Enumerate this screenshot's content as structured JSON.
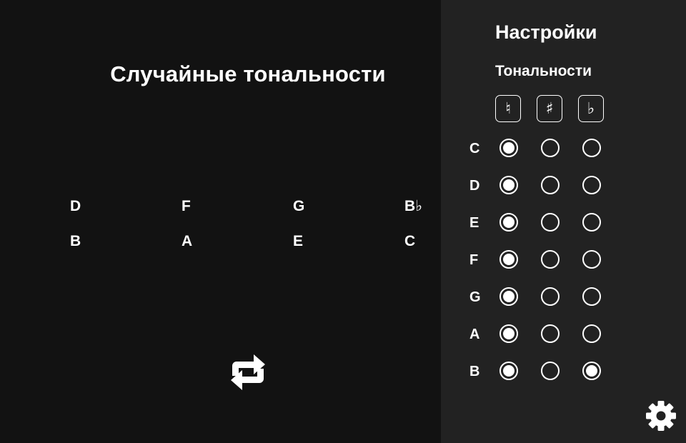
{
  "main": {
    "title": "Случайные тональности",
    "keys": [
      "D",
      "F",
      "G",
      "B♭",
      "B",
      "A",
      "E",
      "C"
    ],
    "refresh_icon": "refresh-icon"
  },
  "settings": {
    "title": "Настройки",
    "section_title": "Тональности",
    "accidentals": [
      {
        "symbol": "♮",
        "icon": "natural-icon"
      },
      {
        "symbol": "♯",
        "icon": "sharp-icon"
      },
      {
        "symbol": "♭",
        "icon": "flat-icon"
      }
    ],
    "rows": [
      {
        "note": "C",
        "selected": "natural"
      },
      {
        "note": "D",
        "selected": "natural"
      },
      {
        "note": "E",
        "selected": "natural"
      },
      {
        "note": "F",
        "selected": "natural"
      },
      {
        "note": "G",
        "selected": "natural"
      },
      {
        "note": "A",
        "selected": "natural"
      },
      {
        "note": "B",
        "selected": [
          "natural",
          "flat"
        ]
      }
    ],
    "gear_icon": "gear-icon"
  }
}
